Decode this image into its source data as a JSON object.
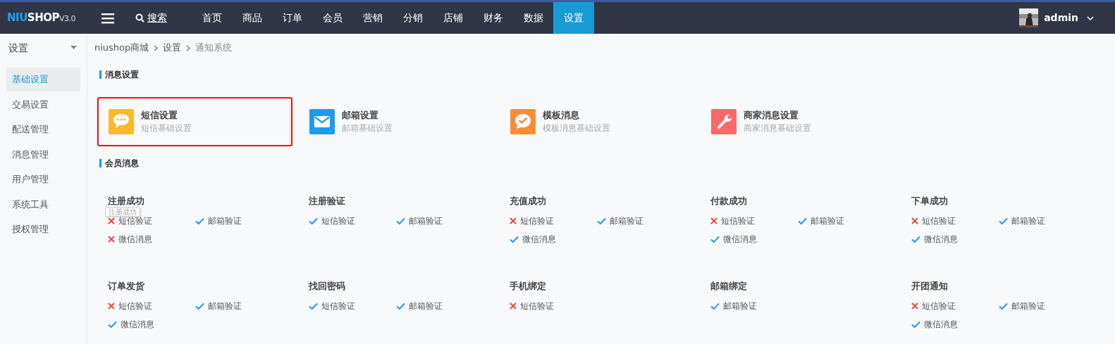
{
  "topbar": {
    "logo": {
      "brand": "NIUSHOP",
      "version": "V3.0"
    },
    "search": "搜索",
    "nav": [
      {
        "label": "首页",
        "selected": false
      },
      {
        "label": "商品",
        "selected": false
      },
      {
        "label": "订单",
        "selected": false
      },
      {
        "label": "会员",
        "selected": false
      },
      {
        "label": "营销",
        "selected": false
      },
      {
        "label": "分销",
        "selected": false
      },
      {
        "label": "店铺",
        "selected": false
      },
      {
        "label": "财务",
        "selected": false
      },
      {
        "label": "数据",
        "selected": false
      },
      {
        "label": "设置",
        "selected": true
      }
    ],
    "user": {
      "name": "admin"
    }
  },
  "sidebar": {
    "title": "设置",
    "items": [
      {
        "label": "基础设置",
        "selected": true
      },
      {
        "label": "交易设置",
        "selected": false
      },
      {
        "label": "配送管理",
        "selected": false
      },
      {
        "label": "消息管理",
        "selected": false
      },
      {
        "label": "用户管理",
        "selected": false
      },
      {
        "label": "系统工具",
        "selected": false
      },
      {
        "label": "授权管理",
        "selected": false
      }
    ]
  },
  "breadcrumb": [
    "niushop商城",
    "设置",
    "通知系统"
  ],
  "message_settings": {
    "title": "消息设置",
    "cards": [
      {
        "kind": "sms",
        "title": "短信设置",
        "subtitle": "短信基础设置",
        "selected": true
      },
      {
        "kind": "email",
        "title": "邮箱设置",
        "subtitle": "邮箱基础设置",
        "selected": false
      },
      {
        "kind": "template",
        "title": "模板消息",
        "subtitle": "模板消息基础设置",
        "selected": false
      },
      {
        "kind": "merchant",
        "title": "商家消息设置",
        "subtitle": "商家消息基础设置",
        "selected": false
      }
    ]
  },
  "member_messages": {
    "title": "会员消息",
    "groups": [
      {
        "title": "注册成功",
        "channels": [
          {
            "label": "短信验证",
            "enabled": false
          },
          {
            "label": "邮箱验证",
            "enabled": true
          },
          {
            "label": "微信消息",
            "enabled": false
          }
        ]
      },
      {
        "title": "注册验证",
        "channels": [
          {
            "label": "短信验证",
            "enabled": true
          },
          {
            "label": "邮箱验证",
            "enabled": true
          }
        ]
      },
      {
        "title": "充值成功",
        "channels": [
          {
            "label": "短信验证",
            "enabled": false
          },
          {
            "label": "邮箱验证",
            "enabled": true
          },
          {
            "label": "微信消息",
            "enabled": true
          }
        ]
      },
      {
        "title": "付款成功",
        "channels": [
          {
            "label": "短信验证",
            "enabled": false
          },
          {
            "label": "邮箱验证",
            "enabled": true
          },
          {
            "label": "微信消息",
            "enabled": true
          }
        ]
      },
      {
        "title": "下单成功",
        "channels": [
          {
            "label": "短信验证",
            "enabled": false
          },
          {
            "label": "邮箱验证",
            "enabled": true
          },
          {
            "label": "微信消息",
            "enabled": true
          }
        ]
      },
      {
        "title": "订单发货",
        "channels": [
          {
            "label": "短信验证",
            "enabled": false
          },
          {
            "label": "邮箱验证",
            "enabled": true
          },
          {
            "label": "微信消息",
            "enabled": true
          }
        ]
      },
      {
        "title": "找回密码",
        "channels": [
          {
            "label": "短信验证",
            "enabled": true
          },
          {
            "label": "邮箱验证",
            "enabled": true
          }
        ]
      },
      {
        "title": "手机绑定",
        "channels": [
          {
            "label": "短信验证",
            "enabled": false
          }
        ]
      },
      {
        "title": "邮箱绑定",
        "channels": [
          {
            "label": "邮箱验证",
            "enabled": true
          }
        ]
      },
      {
        "title": "开团通知",
        "channels": [
          {
            "label": "短信验证",
            "enabled": false
          },
          {
            "label": "邮箱验证",
            "enabled": true
          },
          {
            "label": "微信消息",
            "enabled": true
          }
        ]
      }
    ],
    "tooltip": "注册成功"
  }
}
